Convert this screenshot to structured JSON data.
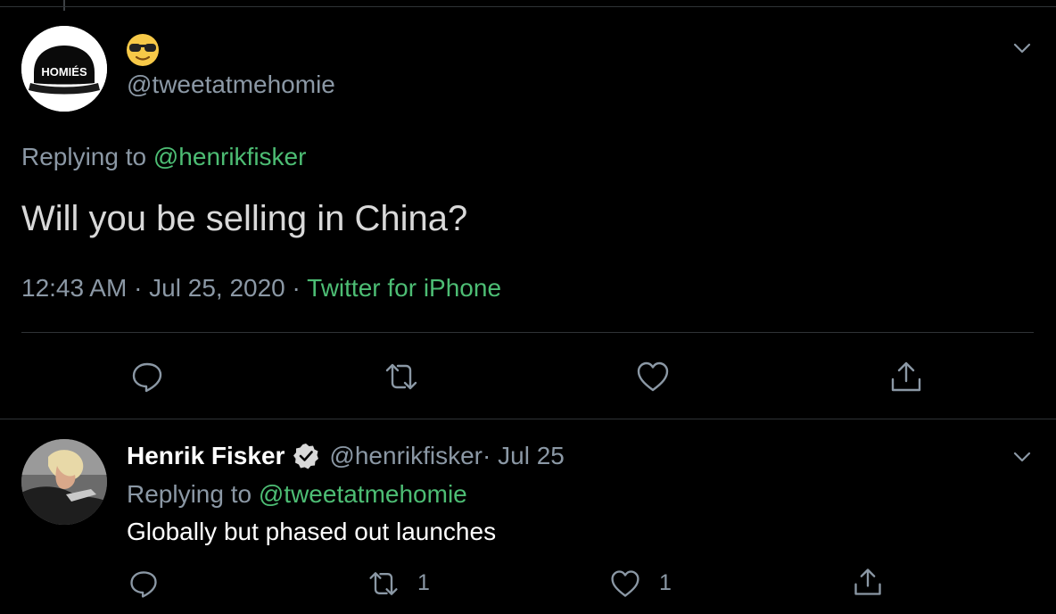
{
  "main_tweet": {
    "handle": "@tweetatmehomie",
    "avatar_text": "HOMIÉS",
    "replying_prefix": "Replying to ",
    "replying_to": "@henrikfisker",
    "text": "Will you be selling in China?",
    "time": "12:43 AM · Jul 25, 2020 · ",
    "source": "Twitter for iPhone",
    "icons": [
      "reply-icon",
      "retweet-icon",
      "like-icon",
      "share-icon",
      "caret-down-icon",
      "sunglasses-emoji-icon"
    ]
  },
  "reply_tweet": {
    "name": "Henrik Fisker",
    "handle": "@henrikfisker",
    "date": " · Jul 25",
    "replying_prefix": "Replying to ",
    "replying_to": "@tweetatmehomie",
    "text": "Globally but phased out launches",
    "retweet_count": "1",
    "like_count": "1",
    "icons": [
      "reply-icon",
      "retweet-icon",
      "like-icon",
      "share-icon",
      "caret-down-icon",
      "verified-badge-icon"
    ]
  },
  "colors": {
    "background": "#000000",
    "accent_green": "#4dbd74",
    "muted": "#8b98a5",
    "divider": "#2f3336"
  }
}
